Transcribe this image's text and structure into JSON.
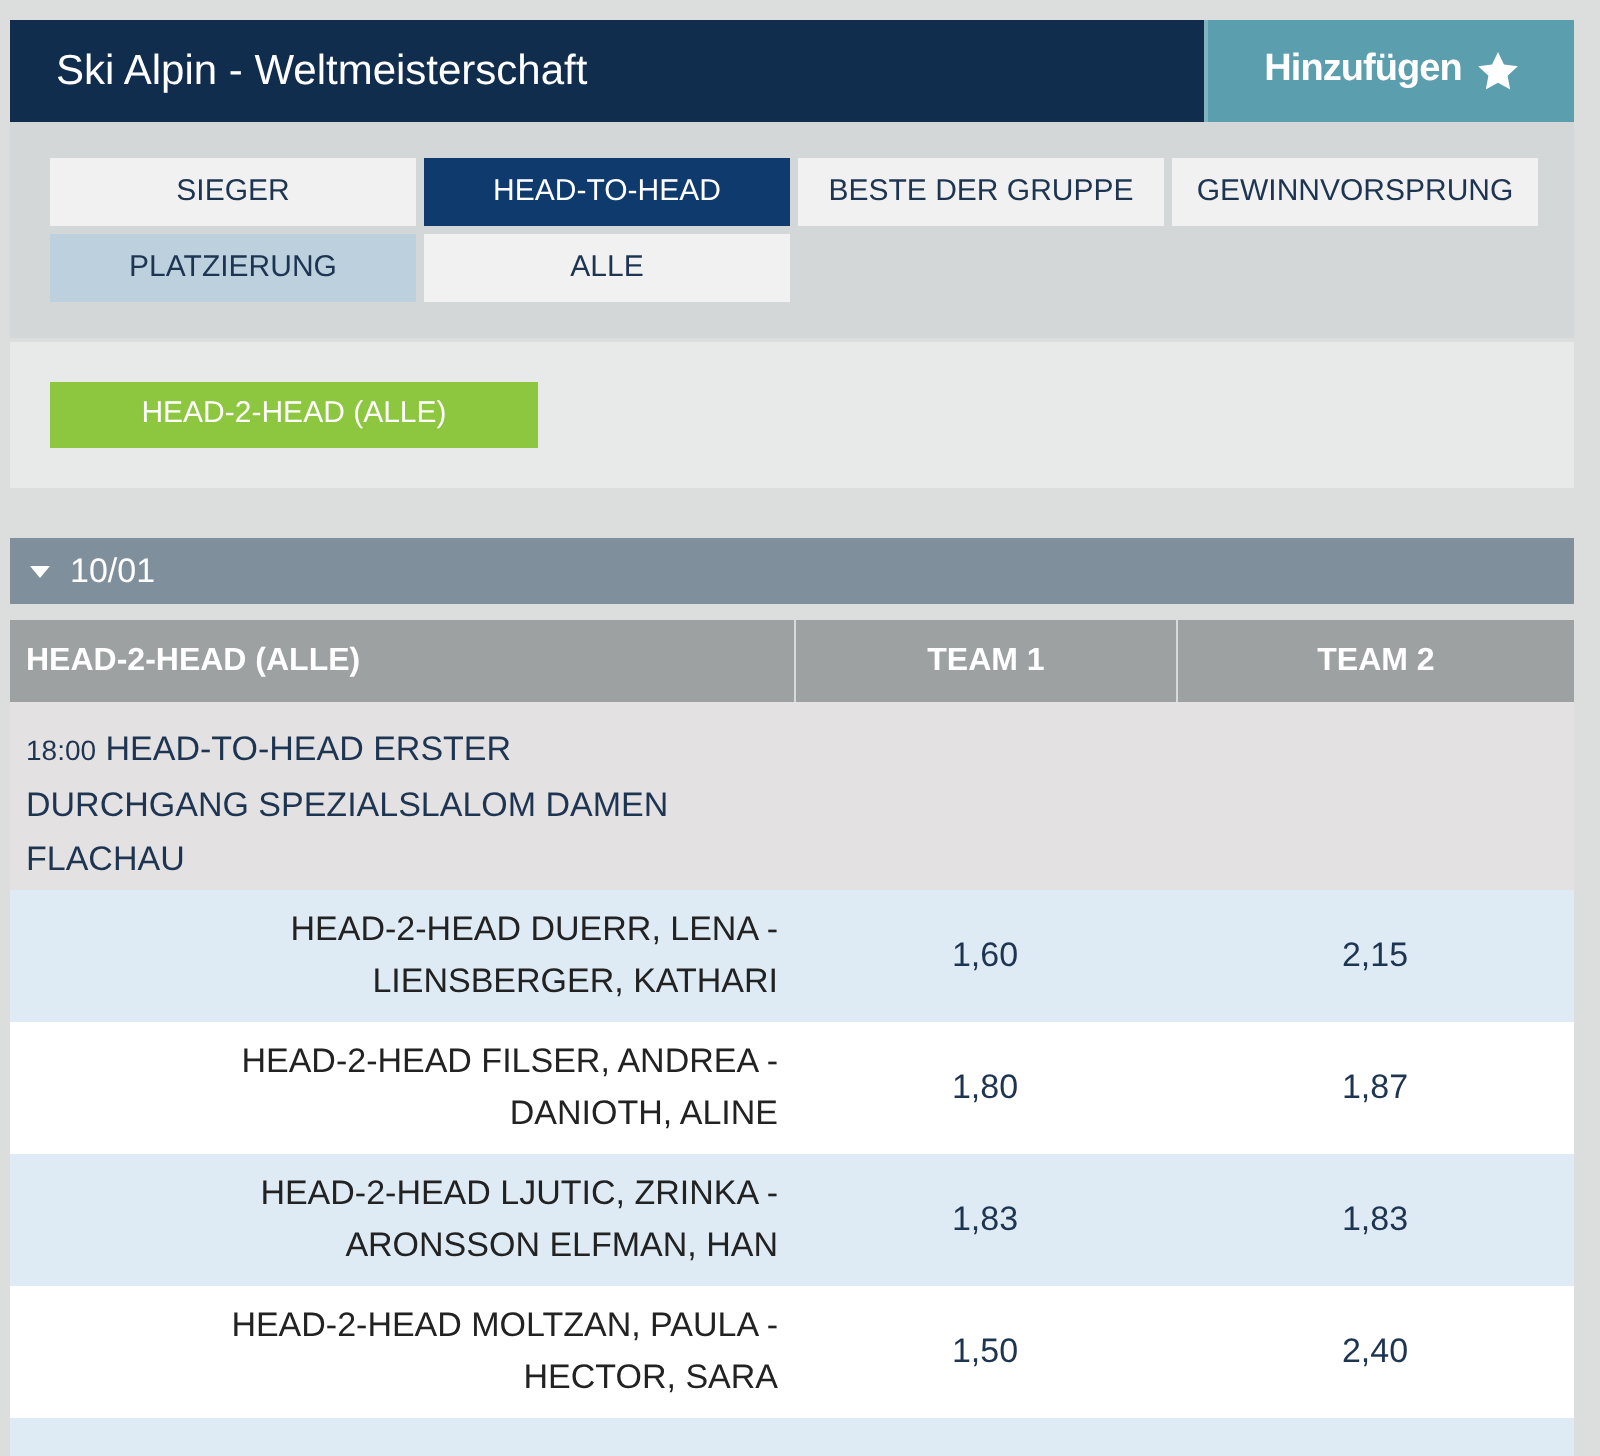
{
  "header": {
    "title": "Ski Alpin - Weltmeisterschaft",
    "add_button": "Hinzufügen"
  },
  "tabs": [
    {
      "label": "SIEGER",
      "selected": false,
      "hovered": false
    },
    {
      "label": "HEAD-TO-HEAD",
      "selected": true,
      "hovered": false
    },
    {
      "label": "BESTE DER GRUPPE",
      "selected": false,
      "hovered": false
    },
    {
      "label": "GEWINNVORSPRUNG",
      "selected": false,
      "hovered": false
    },
    {
      "label": "PLATZIERUNG",
      "selected": false,
      "hovered": true
    },
    {
      "label": "ALLE",
      "selected": false,
      "hovered": false
    }
  ],
  "filter_button": "HEAD-2-HEAD (ALLE)",
  "date_group": {
    "label": "10/01",
    "expanded": true
  },
  "table": {
    "columns": [
      "HEAD-2-HEAD (ALLE)",
      "TEAM 1",
      "TEAM 2"
    ],
    "event": {
      "time": "18:00",
      "name": "HEAD-TO-HEAD ERSTER DURCHGANG SPEZIALSLALOM DAMEN FLACHAU"
    },
    "rows": [
      {
        "match": "HEAD-2-HEAD DUERR, LENA - LIENSBERGER, KATHARI",
        "team_1": "1,60",
        "team_2": "2,15"
      },
      {
        "match": "HEAD-2-HEAD FILSER, ANDREA - DANIOTH, ALINE",
        "team_1": "1,80",
        "team_2": "1,87"
      },
      {
        "match": "HEAD-2-HEAD LJUTIC, ZRINKA - ARONSSON ELFMAN, HAN",
        "team_1": "1,83",
        "team_2": "1,83"
      },
      {
        "match": "HEAD-2-HEAD MOLTZAN, PAULA - HECTOR, SARA",
        "team_1": "1,50",
        "team_2": "2,40"
      }
    ]
  }
}
